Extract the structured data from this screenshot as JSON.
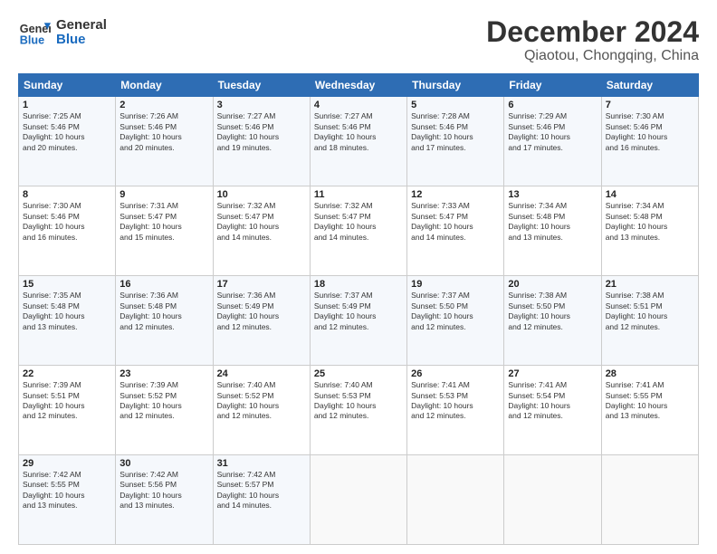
{
  "logo": {
    "line1": "General",
    "line2": "Blue"
  },
  "header": {
    "month": "December 2024",
    "location": "Qiaotou, Chongqing, China"
  },
  "weekdays": [
    "Sunday",
    "Monday",
    "Tuesday",
    "Wednesday",
    "Thursday",
    "Friday",
    "Saturday"
  ],
  "weeks": [
    [
      {
        "day": "1",
        "info": "Sunrise: 7:25 AM\nSunset: 5:46 PM\nDaylight: 10 hours\nand 20 minutes."
      },
      {
        "day": "2",
        "info": "Sunrise: 7:26 AM\nSunset: 5:46 PM\nDaylight: 10 hours\nand 20 minutes."
      },
      {
        "day": "3",
        "info": "Sunrise: 7:27 AM\nSunset: 5:46 PM\nDaylight: 10 hours\nand 19 minutes."
      },
      {
        "day": "4",
        "info": "Sunrise: 7:27 AM\nSunset: 5:46 PM\nDaylight: 10 hours\nand 18 minutes."
      },
      {
        "day": "5",
        "info": "Sunrise: 7:28 AM\nSunset: 5:46 PM\nDaylight: 10 hours\nand 17 minutes."
      },
      {
        "day": "6",
        "info": "Sunrise: 7:29 AM\nSunset: 5:46 PM\nDaylight: 10 hours\nand 17 minutes."
      },
      {
        "day": "7",
        "info": "Sunrise: 7:30 AM\nSunset: 5:46 PM\nDaylight: 10 hours\nand 16 minutes."
      }
    ],
    [
      {
        "day": "8",
        "info": "Sunrise: 7:30 AM\nSunset: 5:46 PM\nDaylight: 10 hours\nand 16 minutes."
      },
      {
        "day": "9",
        "info": "Sunrise: 7:31 AM\nSunset: 5:47 PM\nDaylight: 10 hours\nand 15 minutes."
      },
      {
        "day": "10",
        "info": "Sunrise: 7:32 AM\nSunset: 5:47 PM\nDaylight: 10 hours\nand 14 minutes."
      },
      {
        "day": "11",
        "info": "Sunrise: 7:32 AM\nSunset: 5:47 PM\nDaylight: 10 hours\nand 14 minutes."
      },
      {
        "day": "12",
        "info": "Sunrise: 7:33 AM\nSunset: 5:47 PM\nDaylight: 10 hours\nand 14 minutes."
      },
      {
        "day": "13",
        "info": "Sunrise: 7:34 AM\nSunset: 5:48 PM\nDaylight: 10 hours\nand 13 minutes."
      },
      {
        "day": "14",
        "info": "Sunrise: 7:34 AM\nSunset: 5:48 PM\nDaylight: 10 hours\nand 13 minutes."
      }
    ],
    [
      {
        "day": "15",
        "info": "Sunrise: 7:35 AM\nSunset: 5:48 PM\nDaylight: 10 hours\nand 13 minutes."
      },
      {
        "day": "16",
        "info": "Sunrise: 7:36 AM\nSunset: 5:48 PM\nDaylight: 10 hours\nand 12 minutes."
      },
      {
        "day": "17",
        "info": "Sunrise: 7:36 AM\nSunset: 5:49 PM\nDaylight: 10 hours\nand 12 minutes."
      },
      {
        "day": "18",
        "info": "Sunrise: 7:37 AM\nSunset: 5:49 PM\nDaylight: 10 hours\nand 12 minutes."
      },
      {
        "day": "19",
        "info": "Sunrise: 7:37 AM\nSunset: 5:50 PM\nDaylight: 10 hours\nand 12 minutes."
      },
      {
        "day": "20",
        "info": "Sunrise: 7:38 AM\nSunset: 5:50 PM\nDaylight: 10 hours\nand 12 minutes."
      },
      {
        "day": "21",
        "info": "Sunrise: 7:38 AM\nSunset: 5:51 PM\nDaylight: 10 hours\nand 12 minutes."
      }
    ],
    [
      {
        "day": "22",
        "info": "Sunrise: 7:39 AM\nSunset: 5:51 PM\nDaylight: 10 hours\nand 12 minutes."
      },
      {
        "day": "23",
        "info": "Sunrise: 7:39 AM\nSunset: 5:52 PM\nDaylight: 10 hours\nand 12 minutes."
      },
      {
        "day": "24",
        "info": "Sunrise: 7:40 AM\nSunset: 5:52 PM\nDaylight: 10 hours\nand 12 minutes."
      },
      {
        "day": "25",
        "info": "Sunrise: 7:40 AM\nSunset: 5:53 PM\nDaylight: 10 hours\nand 12 minutes."
      },
      {
        "day": "26",
        "info": "Sunrise: 7:41 AM\nSunset: 5:53 PM\nDaylight: 10 hours\nand 12 minutes."
      },
      {
        "day": "27",
        "info": "Sunrise: 7:41 AM\nSunset: 5:54 PM\nDaylight: 10 hours\nand 12 minutes."
      },
      {
        "day": "28",
        "info": "Sunrise: 7:41 AM\nSunset: 5:55 PM\nDaylight: 10 hours\nand 13 minutes."
      }
    ],
    [
      {
        "day": "29",
        "info": "Sunrise: 7:42 AM\nSunset: 5:55 PM\nDaylight: 10 hours\nand 13 minutes."
      },
      {
        "day": "30",
        "info": "Sunrise: 7:42 AM\nSunset: 5:56 PM\nDaylight: 10 hours\nand 13 minutes."
      },
      {
        "day": "31",
        "info": "Sunrise: 7:42 AM\nSunset: 5:57 PM\nDaylight: 10 hours\nand 14 minutes."
      },
      null,
      null,
      null,
      null
    ]
  ]
}
